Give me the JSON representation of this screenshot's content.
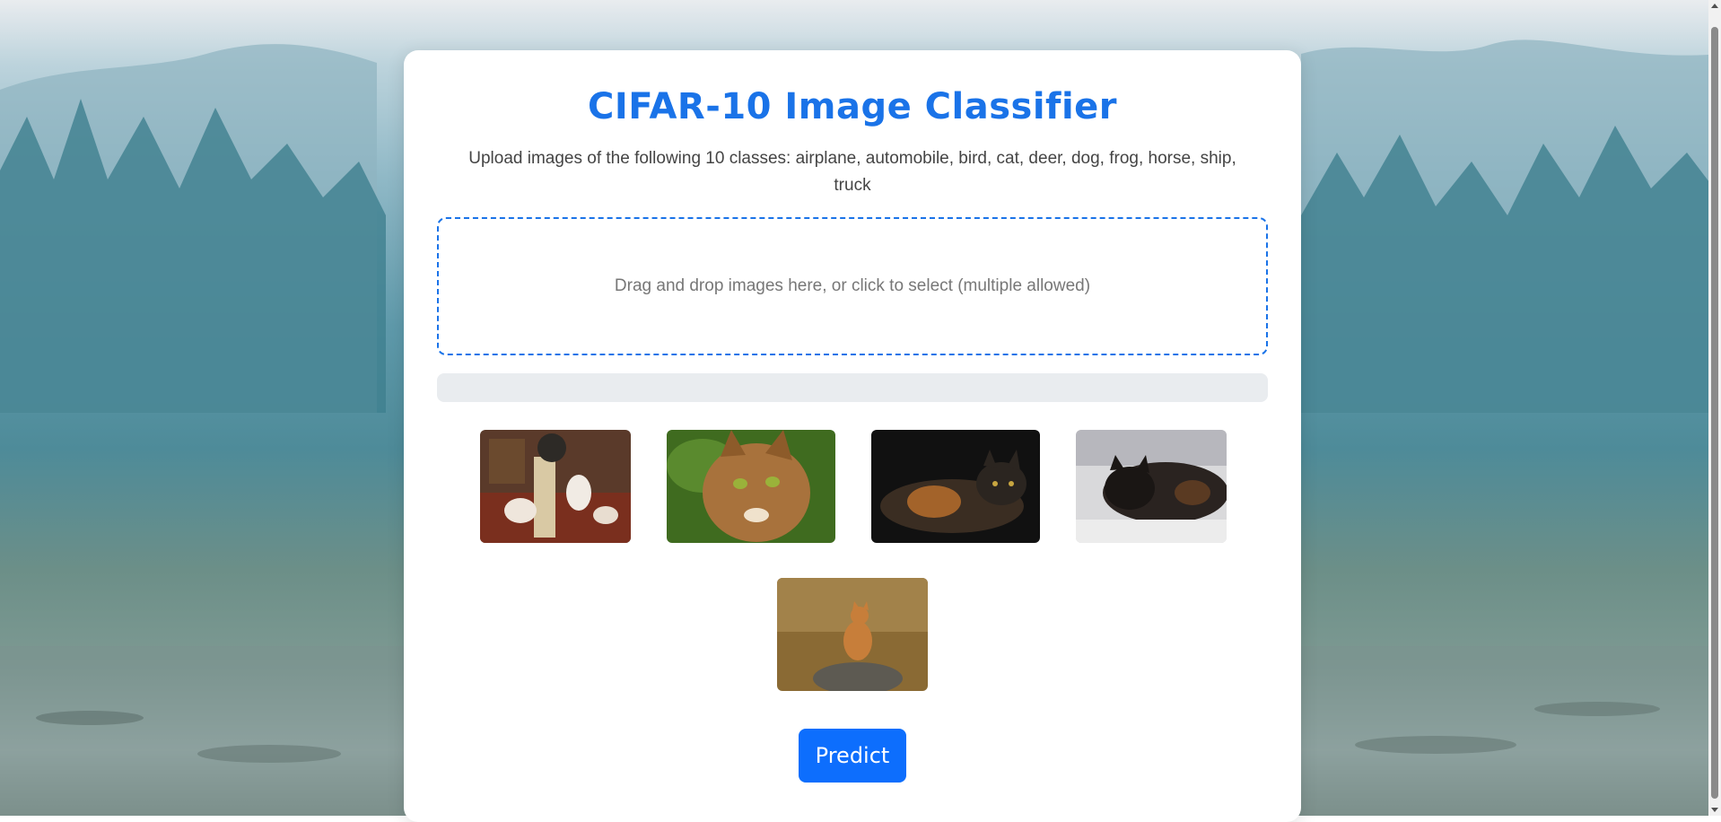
{
  "page": {
    "title": "CIFAR-10 Image Classifier",
    "subtitle": "Upload images of the following 10 classes: airplane, automobile, bird, cat, deer, dog, frog, horse, ship, truck"
  },
  "upload": {
    "dropzone_text": "Drag and drop images here, or click to select (multiple allowed)",
    "progress_fraction": 0
  },
  "images": [
    {
      "name": "cat-kittens-scratching-post"
    },
    {
      "name": "cat-bengal-closeup"
    },
    {
      "name": "cat-tortoiseshell-dark"
    },
    {
      "name": "cat-black-lying"
    },
    {
      "name": "cat-orange-in-grass"
    }
  ],
  "actions": {
    "predict_label": "Predict"
  },
  "colors": {
    "accent": "#1a73e8",
    "button": "#0d6efd",
    "progress_track": "#e9ecef"
  }
}
